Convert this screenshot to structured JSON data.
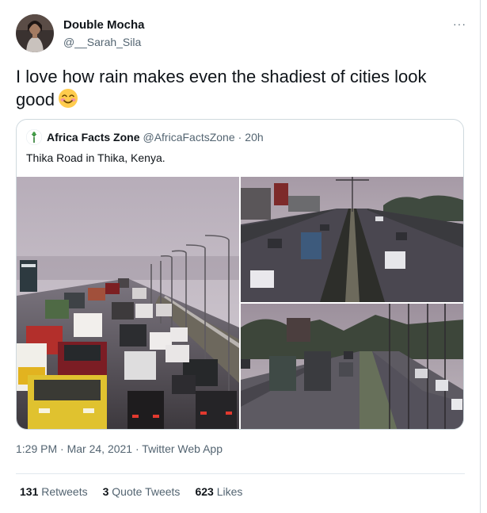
{
  "author": {
    "display_name": "Double Mocha",
    "handle": "@__Sarah_Sila"
  },
  "more_menu": "···",
  "tweet": {
    "text": "I love how rain makes even the shadiest of cities look good",
    "emoji": "smiling-face-icon"
  },
  "quoted_tweet": {
    "display_name": "Africa Facts Zone",
    "handle": "@AfricaFactsZone",
    "separator": "·",
    "time": "20h",
    "text": "Thika Road in Thika, Kenya.",
    "images": [
      "rainy-highway-traffic",
      "highway-overpass-rain",
      "highway-trucks-rain"
    ]
  },
  "meta": {
    "time": "1:29 PM",
    "separator": "·",
    "date": "Mar 24, 2021",
    "client": "Twitter Web App"
  },
  "stats": {
    "retweets_count": "131",
    "retweets_label": "Retweets",
    "quotes_count": "3",
    "quotes_label": "Quote Tweets",
    "likes_count": "623",
    "likes_label": "Likes"
  },
  "colors": {
    "text_primary": "#0f1419",
    "text_secondary": "#536471",
    "border": "#cfd9de"
  }
}
